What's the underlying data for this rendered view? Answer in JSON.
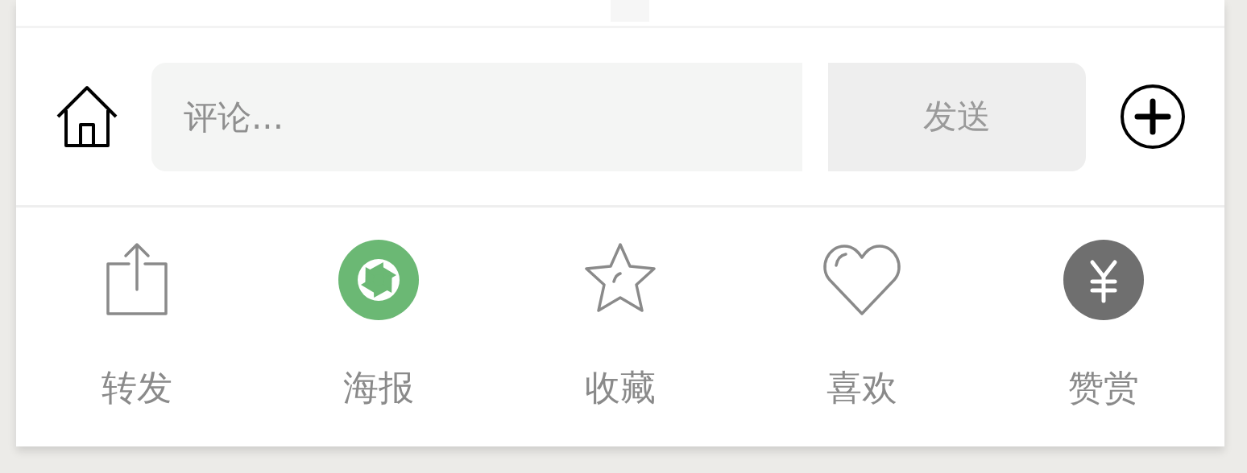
{
  "comment_bar": {
    "placeholder": "评论...",
    "send_label": "发送"
  },
  "actions": [
    {
      "kind": "share",
      "label": "转发"
    },
    {
      "kind": "poster",
      "label": "海报"
    },
    {
      "kind": "favorite",
      "label": "收藏"
    },
    {
      "kind": "like",
      "label": "喜欢"
    },
    {
      "kind": "reward",
      "label": "赞赏"
    }
  ]
}
